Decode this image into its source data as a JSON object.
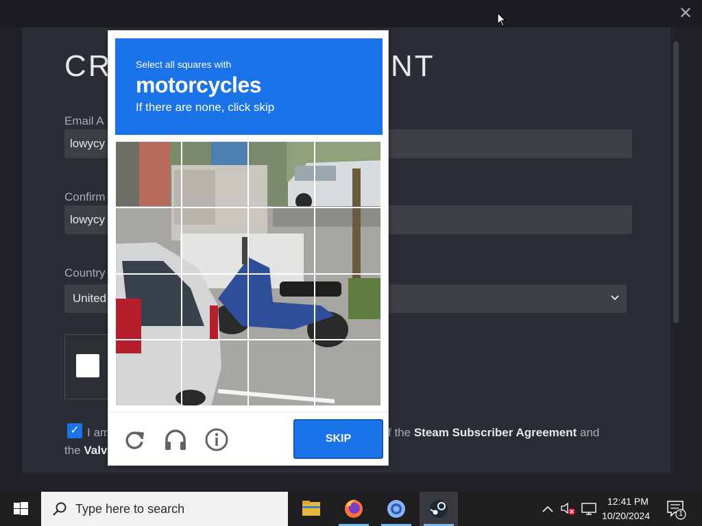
{
  "window": {
    "title_left": "CR",
    "title_right": "NT",
    "close_glyph": "✕"
  },
  "form": {
    "email_label": "Email A",
    "email_value": "lowycy",
    "confirm_label": "Confirm",
    "confirm_value": "lowycy",
    "country_label": "Country",
    "country_value": "United",
    "agree_start": "I am",
    "agree_mid": "f the ",
    "agree_link1": "Steam Subscriber Agreement",
    "agree_end": " and",
    "agree_line2_start": "the ",
    "agree_link2": "Valv"
  },
  "captcha": {
    "instruction_small": "Select all squares with",
    "instruction_target": "motorcycles",
    "instruction_sub": "If there are none, click skip",
    "skip_label": "SKIP",
    "icons": [
      "reload-icon",
      "audio-icon",
      "info-icon"
    ]
  },
  "taskbar": {
    "search_placeholder": "Type here to search",
    "time": "12:41 PM",
    "date": "10/20/2024",
    "notification_count": "1"
  },
  "colors": {
    "captcha_blue": "#1a73e8",
    "steam_bg": "#2a2d33",
    "input_bg": "#3c3f44"
  }
}
